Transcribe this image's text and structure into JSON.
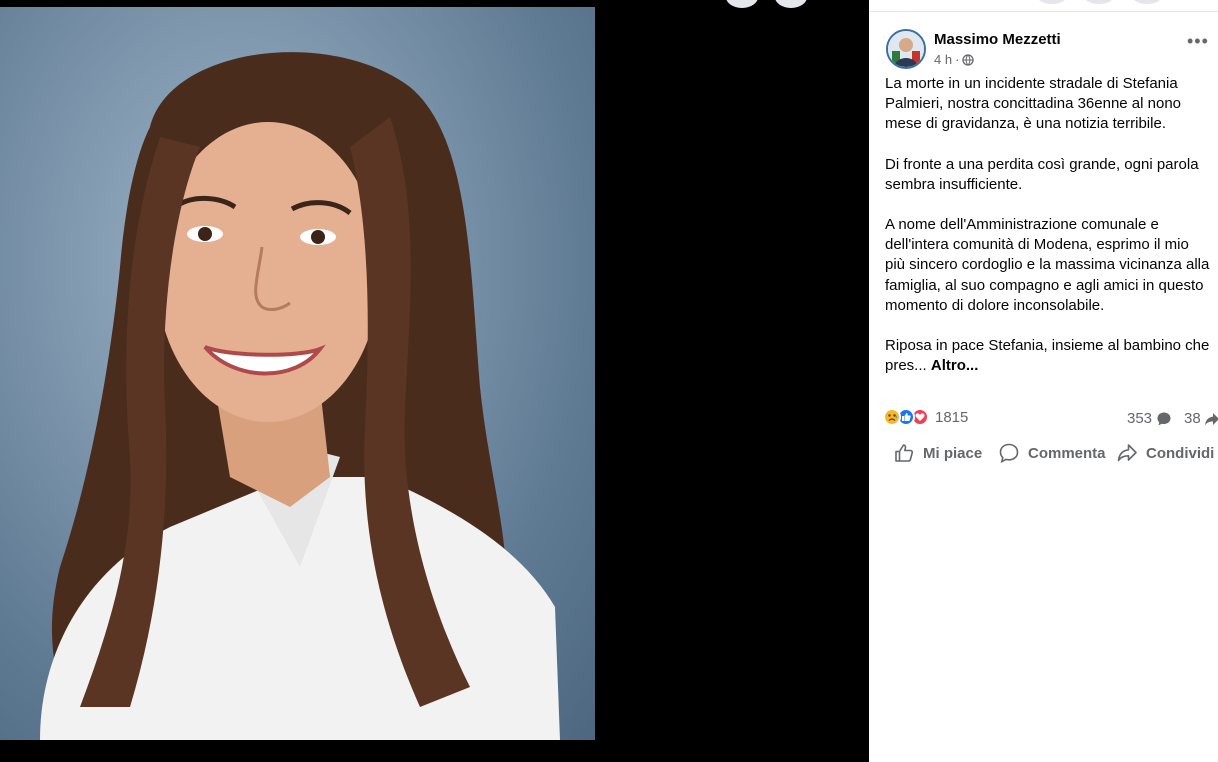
{
  "post": {
    "author": "Massimo Mezzetti",
    "time": "4 h",
    "time_separator": "·",
    "paragraphs": [
      "La morte in un incidente stradale di Stefania Palmieri, nostra concittadina 36enne al nono mese di gravidanza, è una notizia terribile.",
      "Di fronte a una perdita così grande, ogni parola sembra insufficiente.",
      "A nome dell'Amministrazione comunale e dell'intera comunità di Modena, esprimo il mio più sincero cordoglio e la massima vicinanza alla famiglia, al suo compagno e agli amici in questo momento di dolore inconsolabile."
    ],
    "last_paragraph": "Riposa in pace Stefania, insieme al bambino che pres...",
    "see_more": "Altro..."
  },
  "stats": {
    "reactions_count": "1815",
    "comments_count": "353",
    "shares_count": "38",
    "reaction_icons": [
      "sad-reaction-icon",
      "like-reaction-icon",
      "love-reaction-icon"
    ]
  },
  "actions": {
    "like": "Mi piace",
    "comment": "Commenta",
    "share": "Condividi"
  },
  "colors": {
    "like_blue": "#1877f2",
    "love_red": "#f33e58",
    "sad_yellow": "#f7b928",
    "secondary_text": "#65676b"
  }
}
